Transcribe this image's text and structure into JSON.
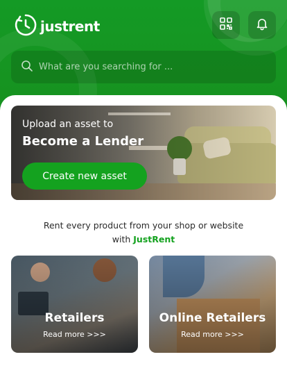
{
  "header": {
    "logo_text": "justrent",
    "search_placeholder": "What are you searching for ..."
  },
  "icons": {
    "logo": "clock-icon",
    "qr": "qr-code-icon",
    "notifications": "bell-icon",
    "search": "search-icon"
  },
  "banner": {
    "subtitle": "Upload an asset to",
    "title": "Become a Lender",
    "cta_label": "Create new asset"
  },
  "tagline": {
    "text": "Rent every product from your shop or website",
    "with": "with",
    "brand": "JustRent"
  },
  "cards": [
    {
      "title": "Retailers",
      "link": "Read more >>>"
    },
    {
      "title": "Online Retailers",
      "link": "Read more >>>"
    }
  ],
  "colors": {
    "brand_green": "#14a21f",
    "header_green": "#149a25"
  }
}
